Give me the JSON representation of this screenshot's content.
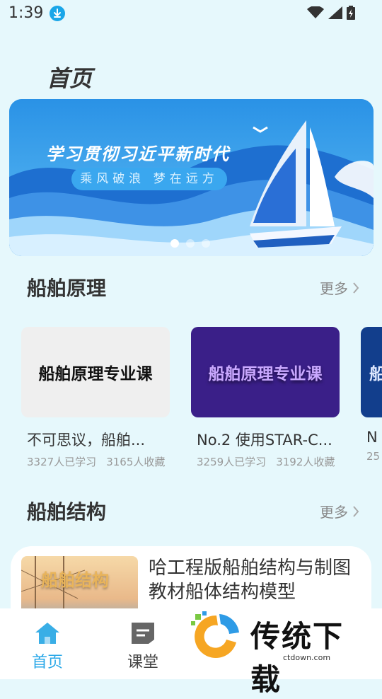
{
  "status": {
    "time": "1:39"
  },
  "page": {
    "title": "首页"
  },
  "banner": {
    "headline": "学习贯彻习近平新时代",
    "subline": "乘风破浪 梦在远方"
  },
  "section1": {
    "title": "船舶原理",
    "more": "更多",
    "courses": [
      {
        "cover_text": "船舶原理专业课",
        "title": "不可思议，船舶...",
        "learners": "3327人已学习",
        "favorites": "3165人收藏"
      },
      {
        "cover_text": "船舶原理专业课",
        "title": "No.2 使用STAR-C...",
        "learners": "3259人已学习",
        "favorites": "3192人收藏"
      },
      {
        "cover_text": "船",
        "title": "N",
        "learners": "25",
        "favorites": ""
      }
    ]
  },
  "section2": {
    "title": "船舶结构",
    "more": "更多",
    "item": {
      "cover_text": "船舶结构",
      "title": "哈工程版船舶结构与制图教材船体结构模型"
    }
  },
  "tabbar": {
    "home": "首页",
    "classroom": "课堂"
  },
  "watermark": {
    "text": "传统下载",
    "url": "ctdown.com"
  },
  "colors": {
    "accent": "#2aa8e8",
    "background": "#e6f8fc"
  }
}
